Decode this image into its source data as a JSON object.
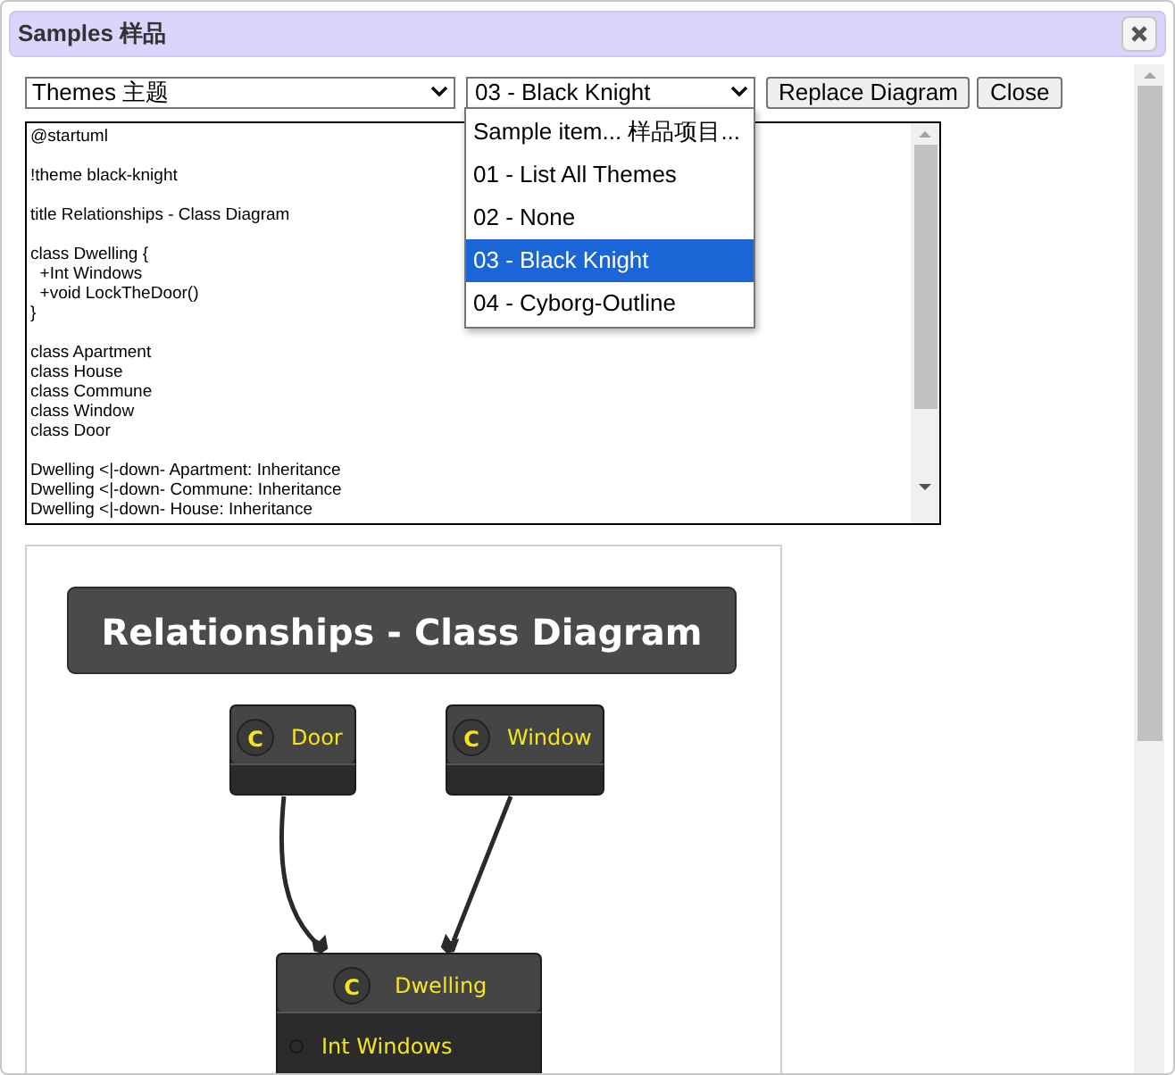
{
  "dialog": {
    "title": "Samples 样品"
  },
  "toolbar": {
    "theme_select": {
      "value": "Themes 主题"
    },
    "sample_select": {
      "value": "03 - Black Knight",
      "expanded": true
    },
    "buttons": [
      "Replace Diagram",
      "Close"
    ]
  },
  "sample_options": [
    {
      "label": "Sample item... 样品项目...",
      "selected": false
    },
    {
      "label": "01 - List All Themes",
      "selected": false
    },
    {
      "label": "02 - None",
      "selected": false
    },
    {
      "label": "03 - Black Knight",
      "selected": true
    },
    {
      "label": "04 - Cyborg-Outline",
      "selected": false
    }
  ],
  "editor": {
    "blocks": [
      [
        "@startuml"
      ],
      [
        "!theme black-knight"
      ],
      [
        "title Relationships - Class Diagram"
      ],
      [
        "class Dwelling {",
        "  +Int Windows",
        "  +void LockTheDoor()",
        "}"
      ],
      [
        "class Apartment",
        "class House",
        "class Commune",
        "class Window",
        "class Door"
      ],
      [
        "Dwelling <|-down- Apartment: Inheritance",
        "Dwelling <|-down- Commune: Inheritance",
        "Dwelling <|-down- House: Inheritance"
      ]
    ]
  },
  "diagram": {
    "title": "Relationships - Class Diagram",
    "classes": [
      {
        "name": "Door",
        "stereotype": "C"
      },
      {
        "name": "Window",
        "stereotype": "C"
      },
      {
        "name": "Dwelling",
        "stereotype": "C",
        "members": [
          "Int Windows"
        ]
      }
    ]
  }
}
